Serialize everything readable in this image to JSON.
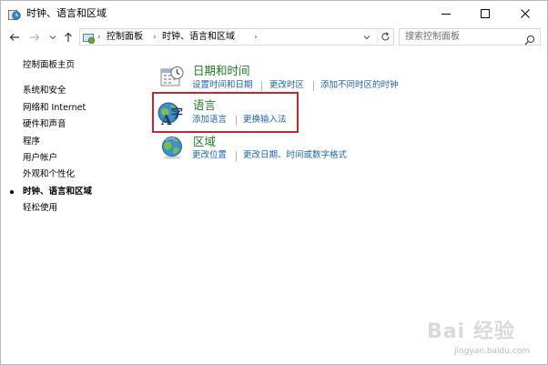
{
  "window": {
    "title": "时钟、语言和区域",
    "minimize_label": "最小化",
    "maximize_label": "最大化",
    "close_label": "关闭"
  },
  "address": {
    "crumbs": [
      "控制面板",
      "时钟、语言和区域"
    ],
    "search_placeholder": "搜索控制面板"
  },
  "sidebar": {
    "home": "控制面板主页",
    "items": [
      {
        "label": "系统和安全",
        "active": false
      },
      {
        "label": "网络和 Internet",
        "active": false
      },
      {
        "label": "硬件和声音",
        "active": false
      },
      {
        "label": "程序",
        "active": false
      },
      {
        "label": "用户帐户",
        "active": false
      },
      {
        "label": "外观和个性化",
        "active": false
      },
      {
        "label": "时钟、语言和区域",
        "active": true
      },
      {
        "label": "轻松使用",
        "active": false
      }
    ]
  },
  "categories": [
    {
      "icon": "calendar-clock-icon",
      "title": "日期和时间",
      "links": [
        "设置时间和日期",
        "更改时区",
        "添加不同时区的时钟"
      ]
    },
    {
      "icon": "language-icon",
      "title": "语言",
      "links": [
        "添加语言",
        "更换输入法"
      ]
    },
    {
      "icon": "globe-icon",
      "title": "区域",
      "links": [
        "更改位置",
        "更改日期、时间或数字格式"
      ]
    }
  ],
  "colors": {
    "category_title": "#1e7b24",
    "link": "#1e62b8",
    "highlight_border": "#c8262f"
  },
  "watermark": {
    "logo": "Bai 经验",
    "url": "jingyan.baidu.com"
  }
}
